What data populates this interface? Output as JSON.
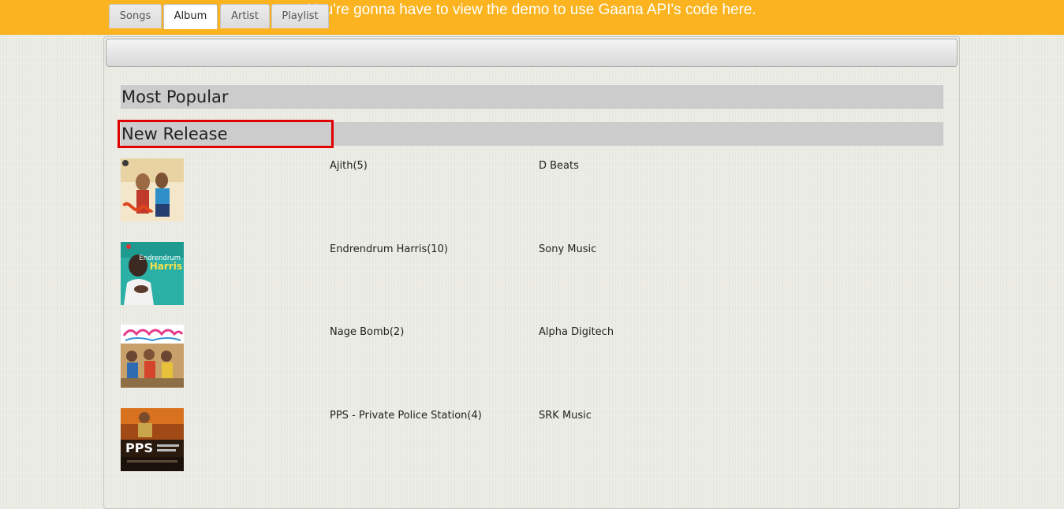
{
  "banner": {
    "text": "You're gonna have to view the demo to use Gaana API's code here."
  },
  "tabs": [
    {
      "label": "Songs"
    },
    {
      "label": "Album"
    },
    {
      "label": "Artist"
    },
    {
      "label": "Playlist"
    }
  ],
  "active_tab": "Album",
  "sections": {
    "most_popular": "Most Popular",
    "new_release": "New Release"
  },
  "albums": [
    {
      "title": "Ajith(5)",
      "label": "D Beats"
    },
    {
      "title": "Endrendrum Harris(10)",
      "label": "Sony Music",
      "cover_text_1": "Endrendrum",
      "cover_text_2": "Harris"
    },
    {
      "title": "Nage Bomb(2)",
      "label": "Alpha Digitech"
    },
    {
      "title": "PPS - Private Police Station(4)",
      "label": "SRK Music",
      "cover_text": "PPS"
    }
  ],
  "colors": {
    "banner": "#fbb41f",
    "section_bg": "#cccccc",
    "highlight": "#e00000"
  }
}
